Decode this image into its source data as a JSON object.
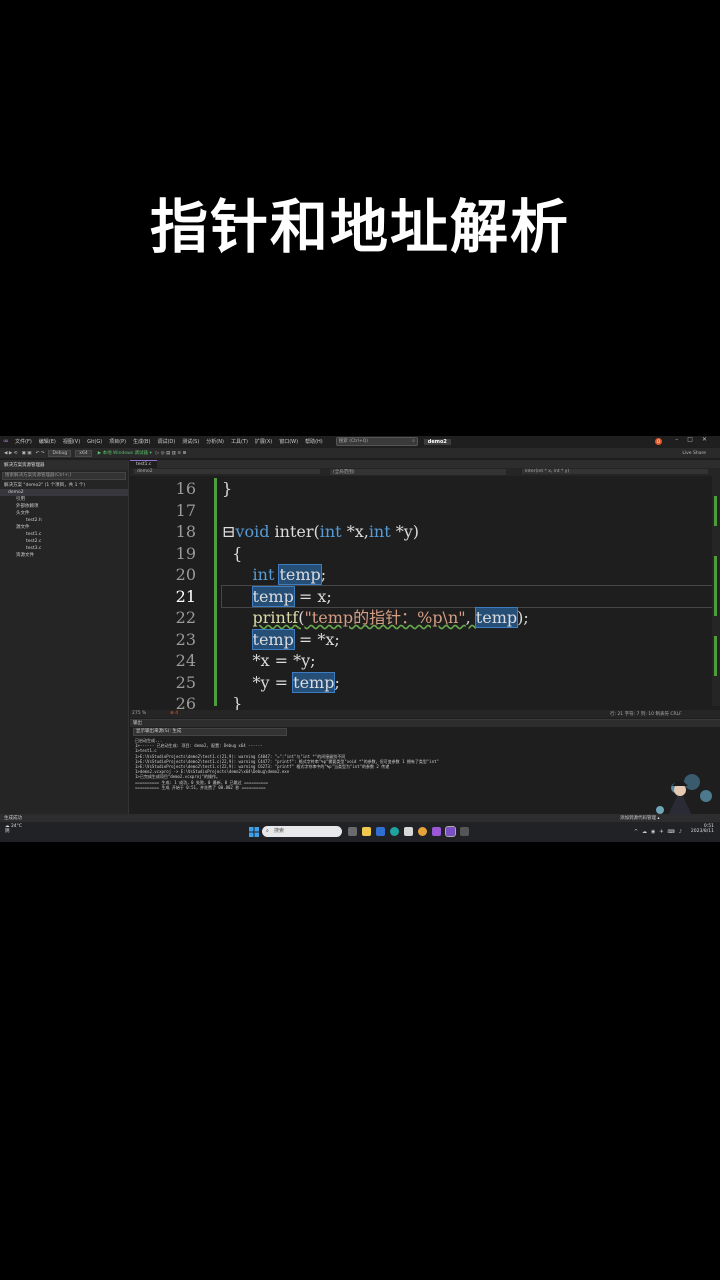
{
  "overlay": {
    "title": "指针和地址解析"
  },
  "menubar": {
    "items": [
      "文件(F)",
      "编辑(E)",
      "视图(V)",
      "Git(G)",
      "项目(P)",
      "生成(B)",
      "调试(D)",
      "测试(S)",
      "分析(N)",
      "工具(T)",
      "扩展(X)",
      "窗口(W)",
      "帮助(H)"
    ],
    "search_placeholder": "搜索 (Ctrl+Q)",
    "project_name": "demo2",
    "account_initial": "O"
  },
  "toolbar": {
    "config": "Debug",
    "platform": "x64",
    "run_label": "▶ 本地 Windows 调试器 ▾",
    "live_share": "Live Share"
  },
  "solution_explorer": {
    "title": "解决方案资源管理器",
    "search_placeholder": "搜索解决方案资源管理器(Ctrl+;)",
    "items": [
      "解决方案 \"demo2\" (1 个项目，共 1 个)",
      "demo2",
      "引用",
      "外部依赖项",
      "头文件",
      "test2.h",
      "源文件",
      "test1.c",
      "test2.c",
      "test3.c",
      "资源文件"
    ],
    "bottom_tabs": "解决方案资源管理器   Git 更改"
  },
  "editor": {
    "tab": "test1.c",
    "nav_left": "demo2",
    "nav_mid": "(全局范围)",
    "nav_right": "inter(int * x, int * y)",
    "line_numbers": [
      "16",
      "17",
      "18",
      "19",
      "20",
      "21",
      "22",
      "23",
      "24",
      "25",
      "26"
    ],
    "current_line": "21",
    "zoom": "275 %",
    "status_right": "行: 21   字符: 7   列: 10   制表符   CRLF"
  },
  "output": {
    "header": "输出",
    "source_label": "显示输出来源(S):  生成",
    "lines": [
      "已启动生成...",
      "1>------ 已启动生成: 项目: demo2, 配置: Debug x64 ------",
      "1>test1.c",
      "1>E:\\VsStudioProjects\\demo2\\test1.c(21,9): warning C4047: \"=\":\"int\"与\"int *\"的间接级别不同",
      "1>E:\\VsStudioProjects\\demo2\\test1.c(22,9): warning C4477: \"printf\": 格式字符串\"%p\"需要类型\"void *\"的参数，但可变参数 1 拥有了类型\"int\"",
      "1>E:\\VsStudioProjects\\demo2\\test1.c(22,9): warning C6273: \"printf\" 格式字符串中的\"%p\"当类型为\"int\"的参数 2 传递",
      "1>demo2.vcxproj -> E:\\VsStudioProjects\\demo2\\x64\\Debug\\demo2.exe",
      "1>已完成生成项目\"demo2.vcxproj\"的操作。",
      "========== 生成: 1 成功，0 失败，0 最新，0 已跳过 ==========",
      "========== 生成 开始于 0:51，并花费了 00.802 秒 =========="
    ]
  },
  "vs_status": {
    "left": "生成成功",
    "right": "添加到源代码管理 ▴"
  },
  "taskbar": {
    "weather_temp": "24°C",
    "weather_desc": "阴",
    "search_label": "搜索",
    "time": "0:51",
    "date": "2023/8/11"
  },
  "colors": {
    "keyword": "#569cd6",
    "string": "#d69d85",
    "highlight": "#264f78",
    "change_bar": "#4f9d3a"
  }
}
